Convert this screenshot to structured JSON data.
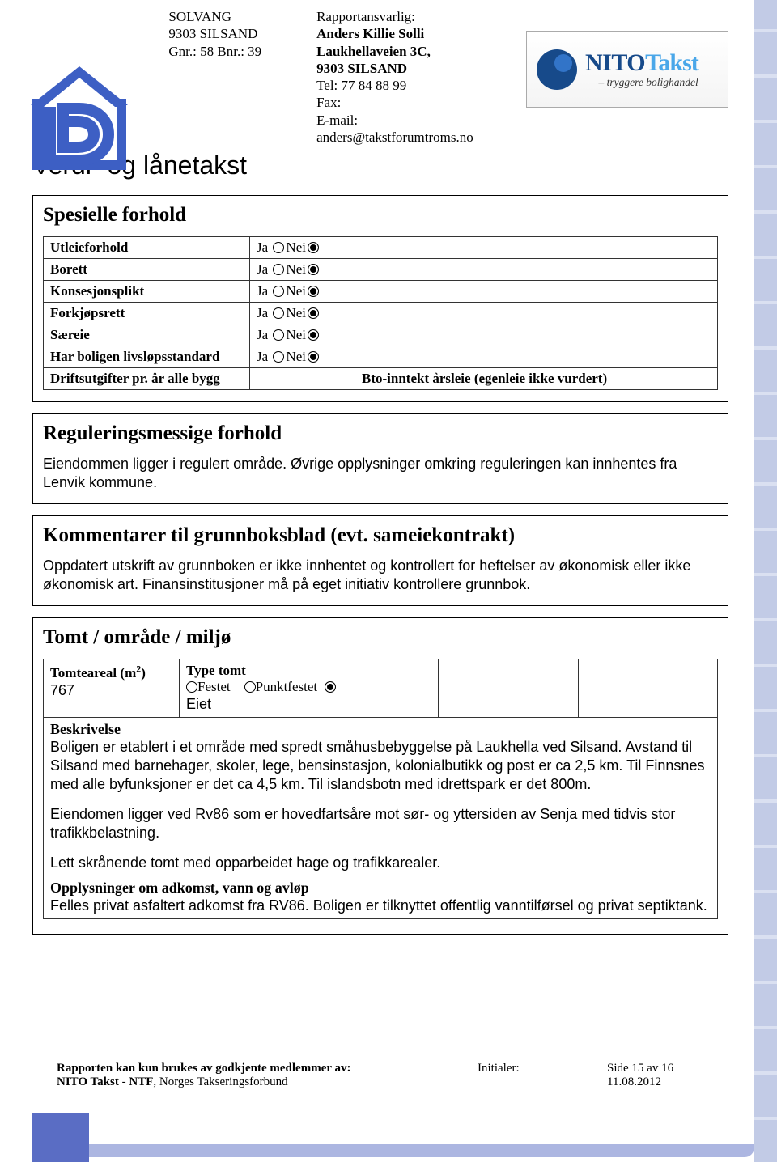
{
  "header": {
    "left": {
      "name": "SOLVANG",
      "addr": "9303 SILSAND",
      "gnrbnr": "Gnr.: 58 Bnr.: 39"
    },
    "mid": {
      "resp_label": "Rapportansvarlig:",
      "resp_name": "Anders Killie Solli",
      "street": "Laukhellaveien 3C,",
      "city": "9303 SILSAND",
      "tel": "Tel: 77 84 88 99",
      "fax": "Fax:",
      "email_label": "E-mail:",
      "email": "anders@takstforumtroms.no"
    },
    "nito": {
      "brand1": "NITO",
      "brand2": "Takst",
      "tagline": "– tryggere bolighandel"
    },
    "doc_title": "Verdi- og lånetakst"
  },
  "spesielle": {
    "heading": "Spesielle forhold",
    "ja": "Ja",
    "nei": "Nei",
    "rows": [
      {
        "label": "Utleieforhold"
      },
      {
        "label": "Borett"
      },
      {
        "label": "Konsesjonsplikt"
      },
      {
        "label": "Forkjøpsrett"
      },
      {
        "label": "Særeie"
      },
      {
        "label": "Har boligen livsløpsstandard"
      }
    ],
    "drifts_label": "Driftsutgifter pr. år alle bygg",
    "bto_text": "Bto-inntekt årsleie (egenleie ikke vurdert)"
  },
  "regulering": {
    "heading": "Reguleringsmessige forhold",
    "body": "Eiendommen ligger i regulert område. Øvrige opplysninger omkring reguleringen kan innhentes fra Lenvik kommune."
  },
  "grunnbok": {
    "heading": "Kommentarer til grunnboksblad (evt. sameiekontrakt)",
    "body": "Oppdatert utskrift av grunnboken er ikke innhentet og kontrollert for heftelser av økonomisk eller ikke økonomisk art. Finansinstitusjoner må på eget initiativ kontrollere grunnbok."
  },
  "tomt": {
    "heading": "Tomt / område / miljø",
    "areal_label_pre": "Tomteareal (m",
    "areal_label_sup": "2",
    "areal_label_post": ")",
    "areal_value": "767",
    "type_label": "Type tomt",
    "festet": "Festet",
    "punktfestet": "Punktfestet",
    "eiet": "Eiet",
    "beskrivelse_label": "Beskrivelse",
    "beskrivelse_p1": "Boligen er etablert i et område med spredt småhusbebyggelse på Laukhella ved Silsand. Avstand til Silsand med barnehager, skoler, lege, bensinstasjon, kolonialbutikk og post er ca 2,5 km. Til Finnsnes med alle byfunksjoner er det ca 4,5 km. Til islandsbotn med idrettspark er det 800m.",
    "beskrivelse_p2": "Eiendomen ligger ved Rv86 som er hovedfartsåre mot sør- og yttersiden av Senja med tidvis stor trafikkbelastning.",
    "beskrivelse_p3": "Lett skrånende tomt med opparbeidet hage og trafikkarealer.",
    "oppl_label": "Opplysninger om adkomst, vann og avløp",
    "oppl_text": "Felles privat asfaltert adkomst fra RV86. Boligen er tilknyttet offentlig vanntilførsel og privat septiktank."
  },
  "footer": {
    "line1": "Rapporten kan kun brukes av godkjente medlemmer av:",
    "line2a": "NITO Takst",
    "line2b": " - ",
    "line2c": "NTF",
    "line2d": ", Norges Takseringsforbund",
    "initialer": "Initialer:",
    "side": "Side 15 av 16",
    "dato": "11.08.2012"
  }
}
